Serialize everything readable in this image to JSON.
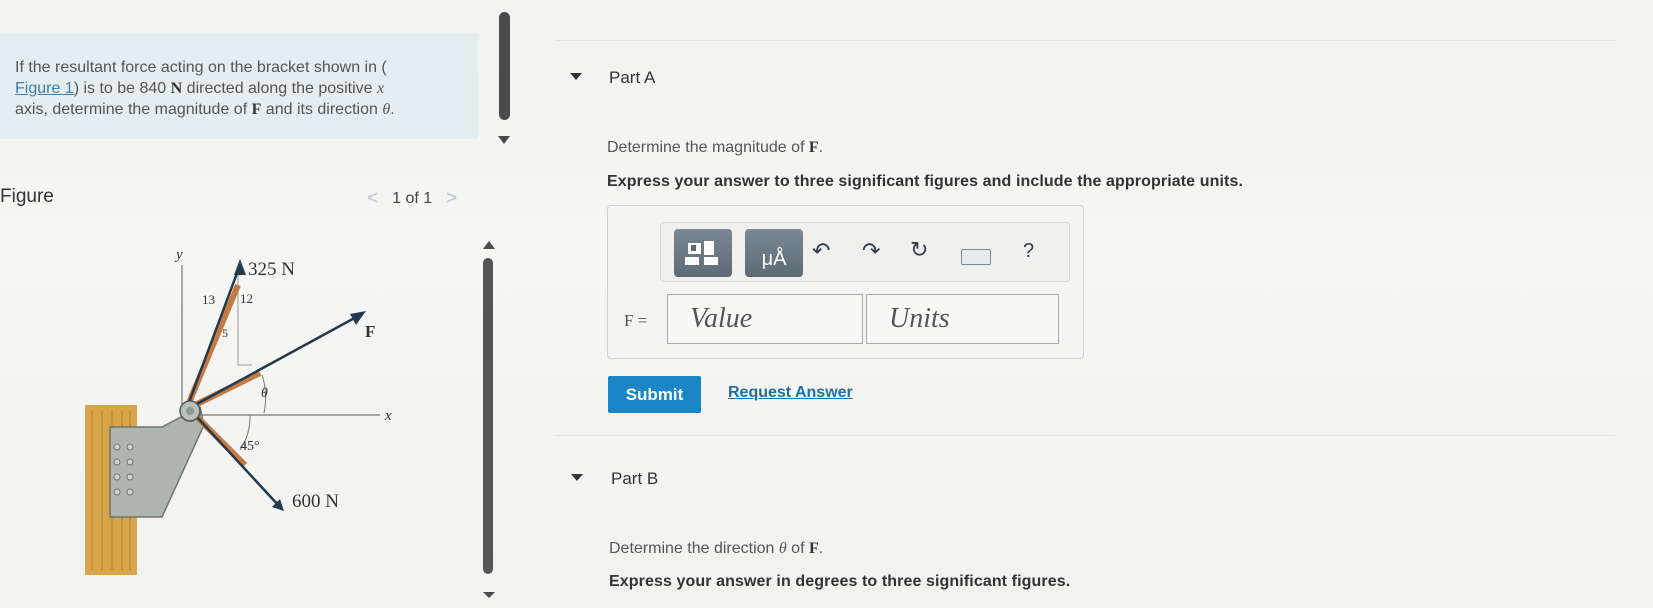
{
  "problem": {
    "text_1": "If the resultant force acting on the bracket shown in (",
    "link": "Figure 1",
    "text_2": ") is to be 840 ",
    "unit_N": "N",
    "text_3": " directed along the positive ",
    "axis_var": "x",
    "text_4": "axis, determine the magnitude of ",
    "force_var": "F",
    "text_5": " and its direction ",
    "angle_var": "θ",
    "text_6": "."
  },
  "figure": {
    "title": "Figure",
    "pager_text": "1 of 1",
    "prev": "<",
    "next": ">",
    "labels": {
      "y": "y",
      "x": "x",
      "F": "F",
      "force_325": "325 N",
      "force_600": "600 N",
      "tri_13": "13",
      "tri_12": "12",
      "tri_5": "5",
      "theta": "θ",
      "angle_45": "45°"
    }
  },
  "partA": {
    "label": "Part A",
    "question_1": "Determine the magnitude of ",
    "question_var": "F",
    "question_2": ".",
    "instruction": "Express your answer to three significant figures and include the appropriate units.",
    "var_label": "F =",
    "value_placeholder": "Value",
    "units_placeholder": "Units",
    "help": "?",
    "units_btn_text": "μÅ",
    "submit": "Submit",
    "request": "Request Answer"
  },
  "partB": {
    "label": "Part B",
    "question_1": "Determine the direction ",
    "question_theta": "θ",
    "question_2": " of ",
    "question_var": "F",
    "question_3": ".",
    "instruction": "Express your answer in degrees to three significant figures."
  }
}
